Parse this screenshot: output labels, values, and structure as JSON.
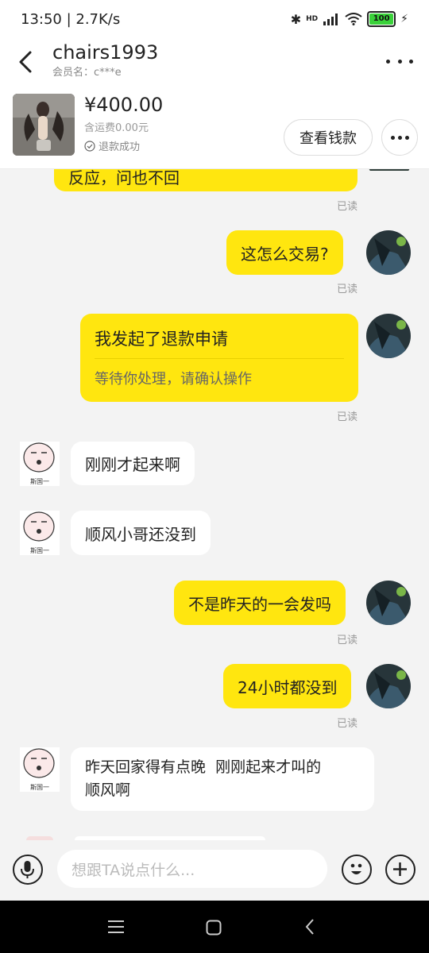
{
  "status": {
    "time": "13:50 | 2.7K/s",
    "battery": "100",
    "network": "HD"
  },
  "header": {
    "title": "chairs1993",
    "subtitle": "会员名：c***e"
  },
  "product": {
    "price": "¥400.00",
    "shipping": "含运费0.00元",
    "refund_status": "退款成功",
    "view_money_label": "查看钱款"
  },
  "messages": [
    {
      "side": "out",
      "text": "反应，问也不回",
      "read": "已读"
    },
    {
      "side": "out",
      "text": "这怎么交易?",
      "read": "已读"
    },
    {
      "side": "out",
      "title": "我发起了退款申请",
      "subtitle": "等待你处理，请确认操作",
      "read": "已读"
    },
    {
      "side": "in",
      "text": "刚刚才起来啊",
      "avatar_caption": "斯国一"
    },
    {
      "side": "in",
      "text": "顺风小哥还没到",
      "avatar_caption": "斯国一"
    },
    {
      "side": "out",
      "text": "不是昨天的一会发吗",
      "read": "已读"
    },
    {
      "side": "out",
      "text": "24小时都没到",
      "read": "已读"
    },
    {
      "side": "in",
      "line1": "昨天回家得有点晚  刚刚起来才叫的",
      "line2": "顺风啊",
      "avatar_caption": "斯国一"
    }
  ],
  "input": {
    "placeholder": "想跟TA说点什么..."
  },
  "icons": {
    "back": "chevron-left-icon",
    "more": "more-dots-icon",
    "voice": "microphone-icon",
    "emoji": "emoji-icon",
    "plus": "plus-icon",
    "check": "check-circle-icon"
  },
  "colors": {
    "bubble_out": "#ffe60f",
    "bubble_in": "#ffffff",
    "background": "#f3f3f3"
  }
}
